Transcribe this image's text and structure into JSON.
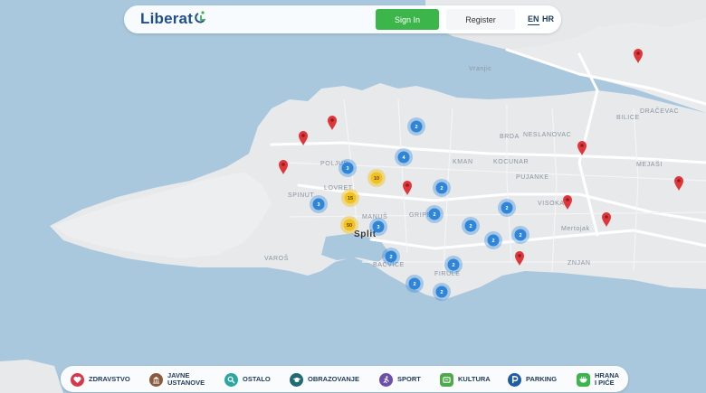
{
  "header": {
    "logo_text": "Liberat",
    "signin_label": "Sign In",
    "register_label": "Register",
    "lang_en": "EN",
    "lang_hr": "HR"
  },
  "map": {
    "city_label": "Split",
    "district_labels": [
      "BRDA",
      "NESLANOVAC",
      "BILICE",
      "DRAČEVAC",
      "POLJUD",
      "KMAN",
      "KOCUNAR",
      "PUJANKE",
      "MEJAŠI",
      "SPINUT",
      "LOVRET",
      "GRIPE",
      "VISOKA",
      "MANUŠ",
      "Mertojak",
      "VAROŠ",
      "BAČVICE",
      "FIRULE",
      "ZNJAN",
      "Vranjic"
    ],
    "clusters_yellow": [
      "10",
      "15",
      "50"
    ],
    "clusters_blue": [
      "2",
      "3",
      "4",
      "3",
      "2",
      "2",
      "3",
      "2",
      "2",
      "2",
      "2",
      "2",
      "2",
      "2",
      "2"
    ]
  },
  "legend": {
    "items": [
      {
        "label": "ZDRAVSTVO",
        "icon": "heart-icon",
        "color": "#d63a4a"
      },
      {
        "label": "JAVNE USTANOVE",
        "icon": "building-icon",
        "color": "#8a5a3c"
      },
      {
        "label": "OSTALO",
        "icon": "search-icon",
        "color": "#2aa7a0"
      },
      {
        "label": "OBRAZOVANJE",
        "icon": "graduation-icon",
        "color": "#1f6a73"
      },
      {
        "label": "SPORT",
        "icon": "running-icon",
        "color": "#6b4fa8"
      },
      {
        "label": "KULTURA",
        "icon": "culture-icon",
        "color": "#4fa84a"
      },
      {
        "label": "PARKING",
        "icon": "parking-icon",
        "color": "#1f5ca8"
      },
      {
        "label": "HRANA I PIĆE",
        "icon": "food-icon",
        "color": "#3cb54a"
      }
    ]
  }
}
